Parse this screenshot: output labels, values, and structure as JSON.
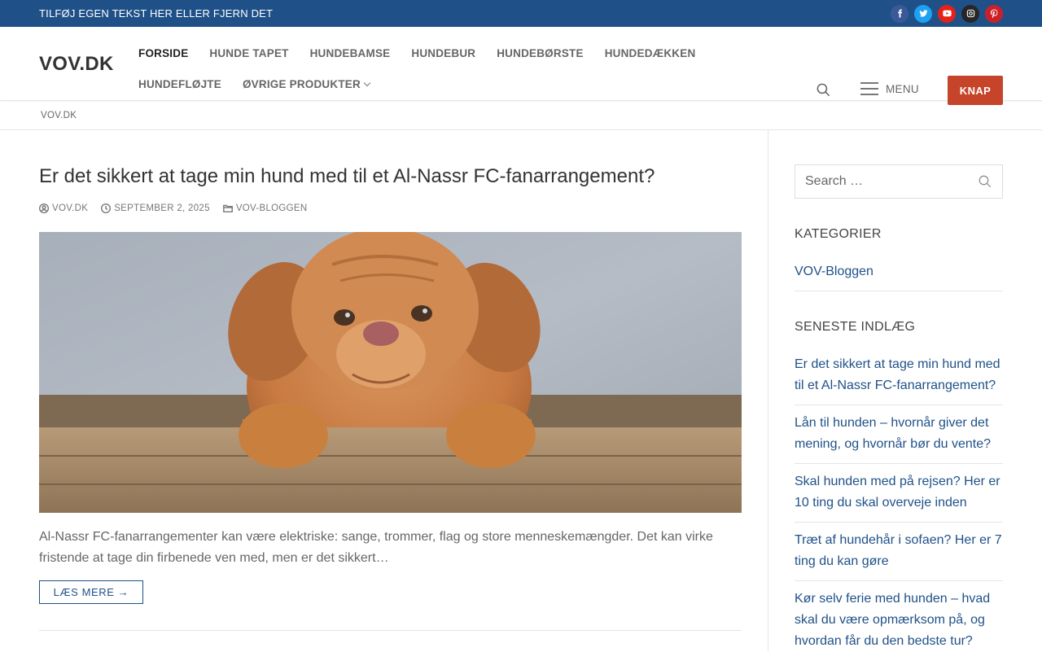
{
  "topbar": {
    "text": "TILFØJ EGEN TEKST HER ELLER FJERN DET",
    "socials": [
      {
        "name": "facebook-icon",
        "color": "#3b5998"
      },
      {
        "name": "twitter-icon",
        "color": "#1da1f2"
      },
      {
        "name": "youtube-icon",
        "color": "#e62117"
      },
      {
        "name": "instagram-icon",
        "color": "#262626"
      },
      {
        "name": "pinterest-icon",
        "color": "#cb2027"
      }
    ]
  },
  "header": {
    "logo": "VOV.DK",
    "nav": [
      "FORSIDE",
      "HUNDE TAPET",
      "HUNDEBAMSE",
      "HUNDEBUR",
      "HUNDEBØRSTE",
      "HUNDEDÆKKEN",
      "HUNDEFLØJTE",
      "ØVRIGE PRODUKTER"
    ],
    "menu_label": "MENU",
    "button_label": "KNAP",
    "accent_color": "#c6442a",
    "brand_color": "#1f5188"
  },
  "breadcrumb": "VOV.DK",
  "post": {
    "title": "Er det sikkert at tage min hund med til et Al-Nassr FC-fanarrangement?",
    "author": "VOV.DK",
    "date": "SEPTEMBER 2, 2025",
    "category": "VOV-BLOGGEN",
    "excerpt": "Al-Nassr FC-fanarrangementer kan være elektriske: sange, trommer, flag og store menneskemængder. Det kan virke fristende at tage din firbenede ven med, men er det sikkert…",
    "readmore": "LÆS MERE →"
  },
  "sidebar": {
    "search_placeholder": "Search …",
    "categories_title": "KATEGORIER",
    "categories": [
      "VOV-Bloggen"
    ],
    "recent_title": "SENESTE INDLÆG",
    "recent": [
      "Er det sikkert at tage min hund med til et Al-Nassr FC-fanarrangement?",
      "Lån til hunden – hvornår giver det mening, og hvornår bør du vente?",
      "Skal hunden med på rejsen? Her er 10 ting du skal overveje inden",
      "Træt af hundehår i sofaen? Her er 7 ting du kan gøre",
      "Kør selv ferie med hunden – hvad skal du være opmærksom på, og hvordan får du den bedste tur?"
    ]
  }
}
